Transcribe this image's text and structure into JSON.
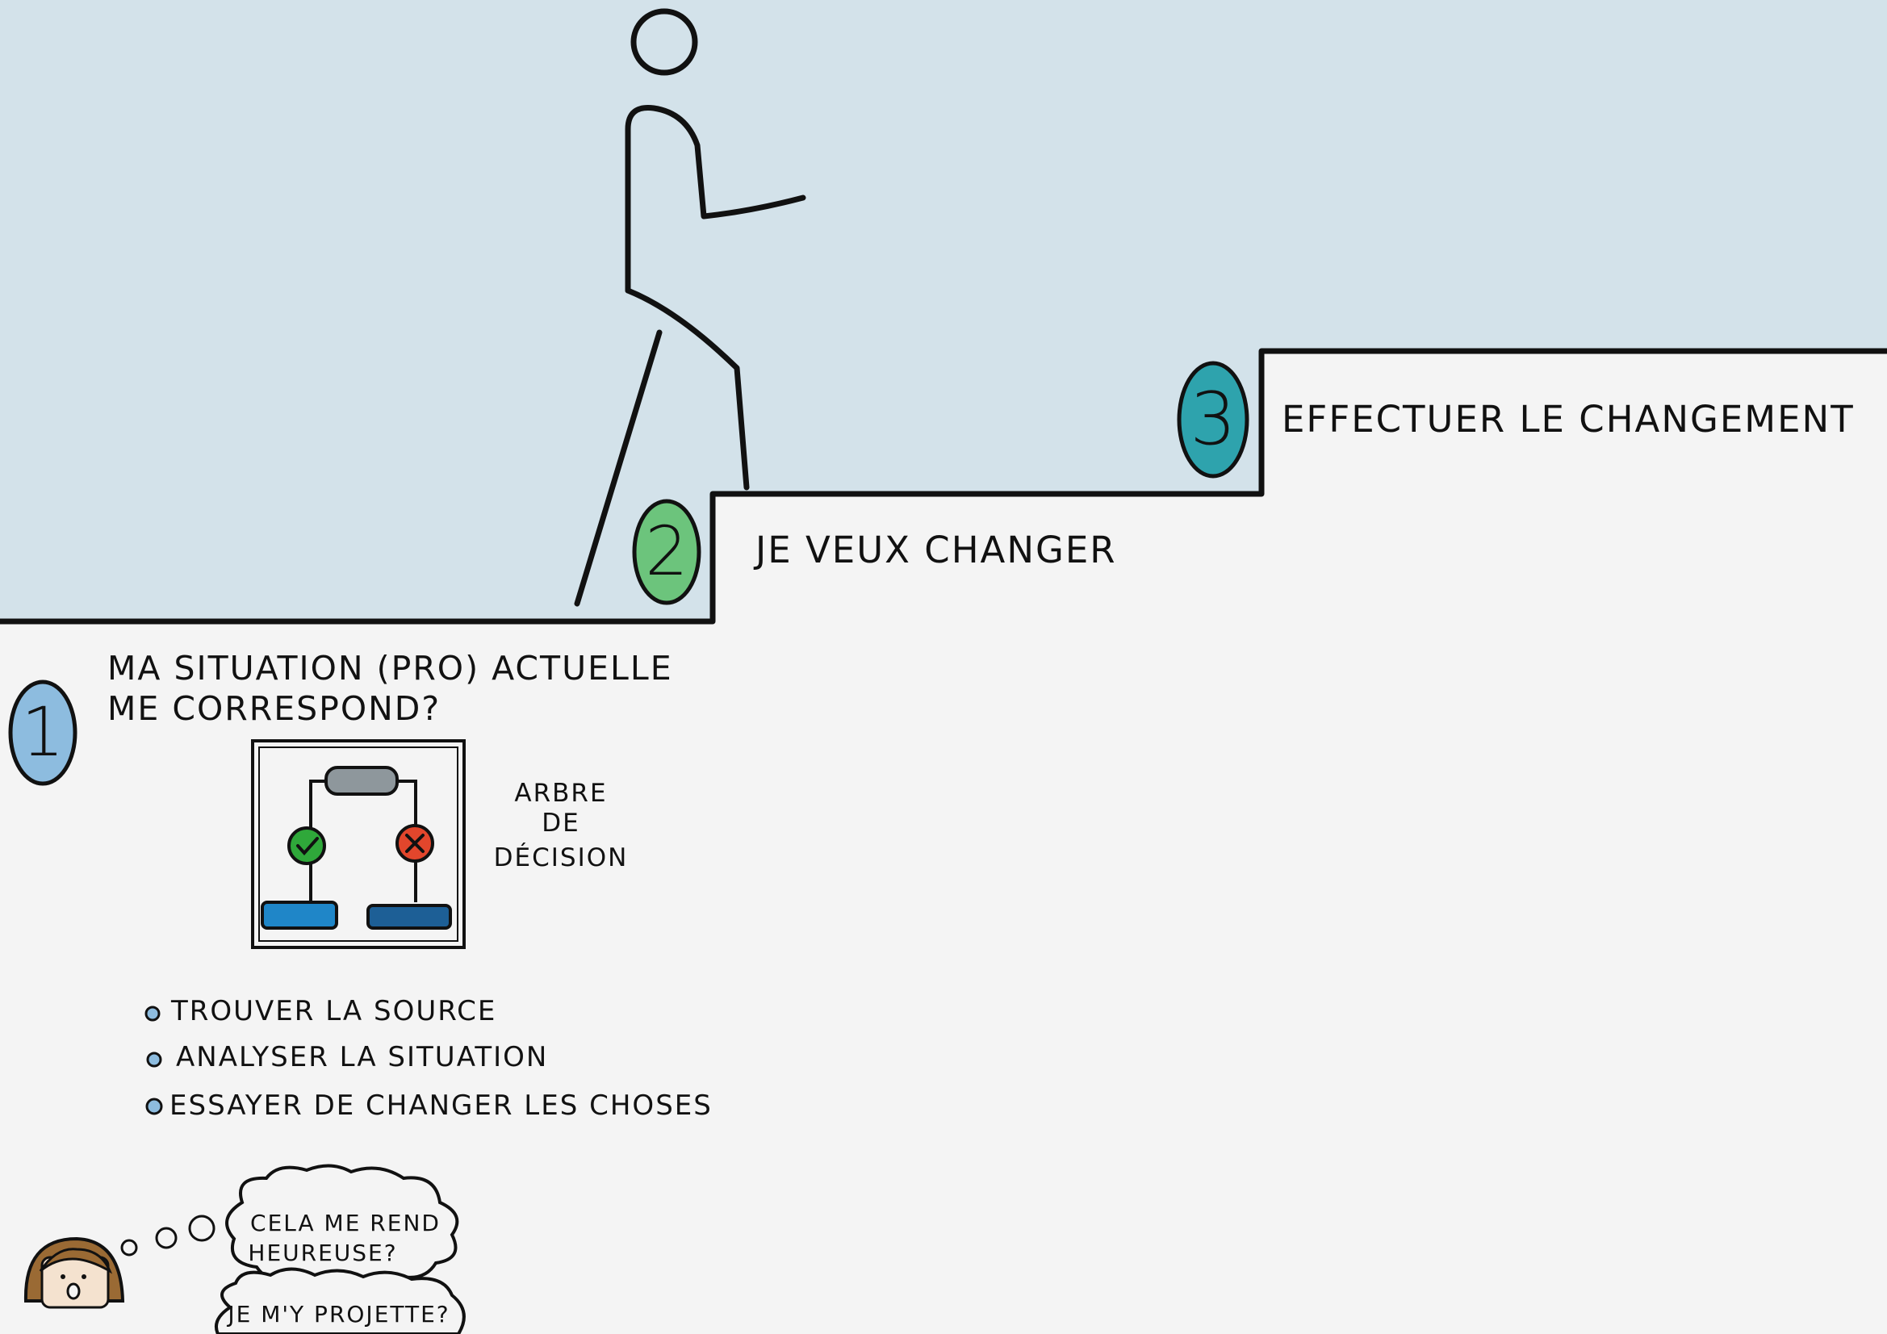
{
  "colors": {
    "sky": "#d3e2ea",
    "ground": "#f4f4f4",
    "line": "#111111",
    "step1_badge": "#8dbcdf",
    "step2_badge": "#6cc47c",
    "step3_badge": "#2ea3ad",
    "bullet": "#8dbcdf",
    "tree_top": "#8e979c",
    "tree_yes": "#2fa83a",
    "tree_no": "#e2462c",
    "tree_left_box": "#1f86c8",
    "tree_right_box": "#1d5f96",
    "hair": "#9a6a34"
  },
  "steps": [
    {
      "number": "1",
      "text_lines": [
        "MA SITUATION (PRO) ACTUELLE",
        "ME CORRESPOND?"
      ]
    },
    {
      "number": "2",
      "text": "JE VEUX CHANGER"
    },
    {
      "number": "3",
      "text": "EFFECTUER LE CHANGEMENT"
    }
  ],
  "decision_tree": {
    "label_lines": [
      "ARBRE",
      "DE",
      "DÉCISION"
    ],
    "yes_icon": "check-icon",
    "no_icon": "cross-icon"
  },
  "actions": [
    "TROUVER LA SOURCE",
    "ANALYSER LA SITUATION",
    "ESSAYER DE CHANGER LES CHOSES"
  ],
  "thoughts": [
    {
      "lines": [
        "CELA ME REND",
        "HEUREUSE?"
      ]
    },
    {
      "lines": [
        "JE M'Y PROJETTE?"
      ]
    }
  ]
}
